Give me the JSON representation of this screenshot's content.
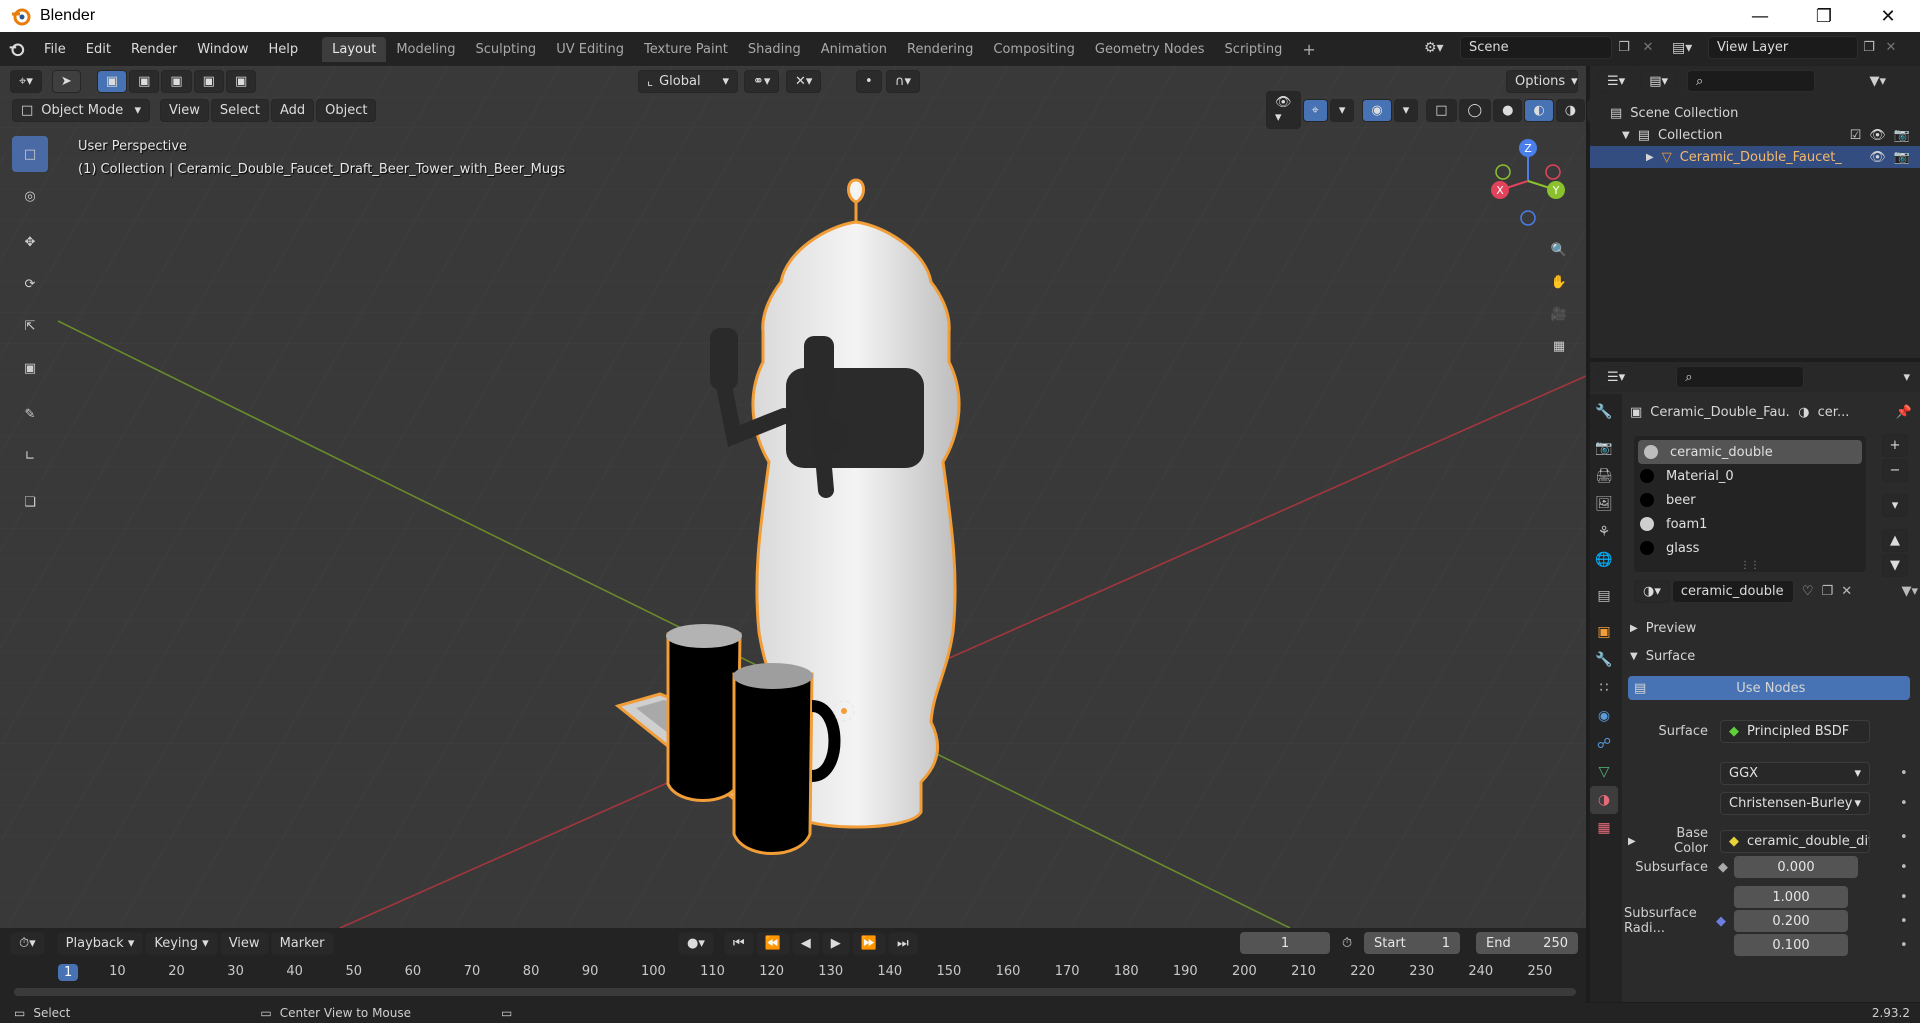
{
  "app": {
    "title": "Blender"
  },
  "menu": [
    "File",
    "Edit",
    "Render",
    "Window",
    "Help"
  ],
  "workspaces": [
    "Layout",
    "Modeling",
    "Sculpting",
    "UV Editing",
    "Texture Paint",
    "Shading",
    "Animation",
    "Rendering",
    "Compositing",
    "Geometry Nodes",
    "Scripting"
  ],
  "active_workspace": "Layout",
  "scene": {
    "name": "Scene",
    "view_layer": "View Layer"
  },
  "viewport": {
    "mode": "Object Mode",
    "menus": [
      "View",
      "Select",
      "Add",
      "Object"
    ],
    "orientation": "Global",
    "options_label": "Options",
    "perspective_label": "User Perspective",
    "collection_label": "(1) Collection | Ceramic_Double_Faucet_Draft_Beer_Tower_with_Beer_Mugs",
    "gizmo": {
      "x": "X",
      "y": "Y",
      "z": "Z"
    }
  },
  "outliner": {
    "scene_collection": "Scene Collection",
    "collection": "Collection",
    "object": "Ceramic_Double_Faucet_"
  },
  "properties": {
    "object_name": "Ceramic_Double_Fau...",
    "material_short": "cer...",
    "material_slots": [
      {
        "name": "ceramic_double",
        "color": "#bdbdbd"
      },
      {
        "name": "Material_0",
        "color": "#000000"
      },
      {
        "name": "beer",
        "color": "#000000"
      },
      {
        "name": "foam1",
        "color": "#cfcfcf"
      },
      {
        "name": "glass",
        "color": "#000000"
      }
    ],
    "active_material": "ceramic_double",
    "preview_label": "Preview",
    "surface_section": "Surface",
    "use_nodes_label": "Use Nodes",
    "surface_label": "Surface",
    "surface_value": "Principled BSDF",
    "distribution": "GGX",
    "subsurface_method": "Christensen-Burley",
    "base_color_label": "Base Color",
    "base_color_value": "ceramic_double_diff...",
    "subsurface_label": "Subsurface",
    "subsurface_value": "0.000",
    "subsurface_radius_label": "Subsurface Radi...",
    "subsurface_radius": [
      "1.000",
      "0.200",
      "0.100"
    ]
  },
  "timeline": {
    "menus": [
      "Playback",
      "Keying",
      "View",
      "Marker"
    ],
    "current_frame": "1",
    "start_label": "Start",
    "start_value": "1",
    "end_label": "End",
    "end_value": "250",
    "ticks": [
      "1",
      "10",
      "20",
      "30",
      "40",
      "50",
      "60",
      "70",
      "80",
      "90",
      "100",
      "110",
      "120",
      "130",
      "140",
      "150",
      "160",
      "170",
      "180",
      "190",
      "200",
      "210",
      "220",
      "230",
      "240",
      "250"
    ]
  },
  "status": {
    "select": "Select",
    "center_view": "Center View to Mouse",
    "version": "2.93.2"
  },
  "colors": {
    "accent": "#4772b3",
    "selection_outline": "#f19d38",
    "active_tab": "#3d3d3d"
  }
}
